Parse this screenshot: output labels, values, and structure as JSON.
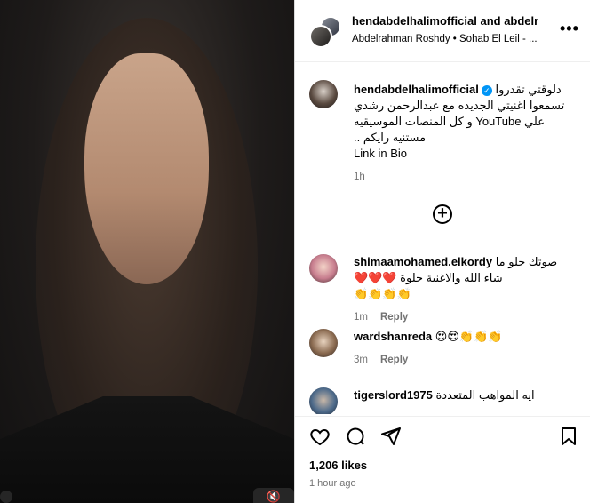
{
  "post": {
    "header": {
      "title": "hendabdelhalimofficial and abdelr",
      "subtitle": "Abdelrahman Roshdy • Sohab El Leil - ...",
      "more_icon": "more-horizontal-icon"
    },
    "caption": {
      "username": "hendabdelhalimofficial",
      "line1": "دلوقتي تقدروا",
      "line2": "تسمعوا اغنيتي الجديده مع عبدالرحمن رشدي",
      "line3": "علي YouTube و كل المنصات الموسيقيه",
      "line4": "مستنيه رايكم ..",
      "line5": "Link in Bio",
      "time": "1h"
    },
    "load_more_icon": "plus-circle-icon",
    "comments": [
      {
        "username": "shimaamohamed.elkordy",
        "text1": "صوتك حلو ما",
        "text2": "شاء الله والاغنية حلوة ❤️❤️❤️",
        "text3": "👏👏👏👏",
        "time": "1m",
        "reply": "Reply"
      },
      {
        "username": "wardshanreda",
        "text1": "😍😍👏👏👏",
        "time": "3m",
        "reply": "Reply"
      },
      {
        "username": "tigerslord1975",
        "text1": "ايه المواهب المتعددة",
        "time": "",
        "reply": ""
      }
    ],
    "likes": "1,206 likes",
    "posted": "1 hour ago",
    "icons": {
      "like": "heart-icon",
      "comment": "comment-icon",
      "share": "send-icon",
      "save": "bookmark-icon",
      "mute": "speaker-muted-icon"
    }
  }
}
